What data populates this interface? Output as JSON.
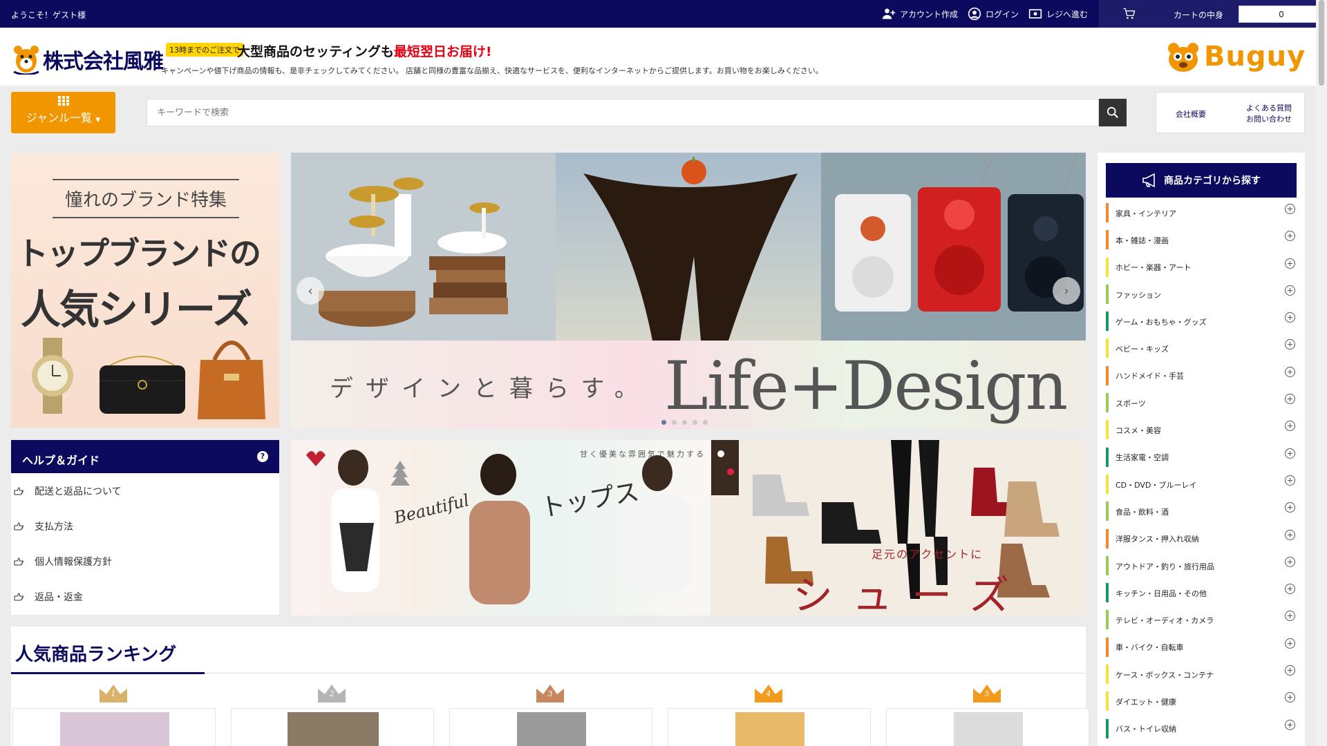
{
  "topbar": {
    "welcome": "ようこそ！ゲスト様",
    "create_account": "アカウント作成",
    "login": "ログイン",
    "checkout": "レジへ進む",
    "cart_label": "カートの中身",
    "cart_count": "0"
  },
  "header": {
    "company": "株式会社風雅",
    "promo_badge": "13時までのご注文で",
    "promo_main": "大型商品のセッティングも",
    "promo_red": "最短翌日お届け!",
    "tagline": "キャンペーンや値下げ商品の情報も、是非チェックしてみてください。 店舗と同様の豊富な品揃え、快適なサービスを、便利なインターネットからご提供します。お買い物をお楽しみください。",
    "brand": "Buguy"
  },
  "search": {
    "genre_label": "ジャンル一覧",
    "placeholder": "キーワードで検索"
  },
  "info_links": {
    "company": "会社概要",
    "faq_line1": "よくある質問",
    "faq_line2": "お問い合わせ"
  },
  "brand_banner": {
    "title": "憧れのブランド特集",
    "line1": "トップブランドの",
    "line2": "人気シリーズ"
  },
  "carousel": {
    "strip_jp": "デザインと暮らす。",
    "strip_en": "Life+Design",
    "slide_count": 5,
    "active_slide": 1
  },
  "help": {
    "title": "ヘルプ＆ガイド",
    "items": [
      "配送と返品について",
      "支払方法",
      "個人情報保護方針",
      "返品・返金"
    ]
  },
  "fashion_banner": {
    "subtitle": "甘く優美な雰囲気で魅力する",
    "english": "Beautiful",
    "japanese": "トップス"
  },
  "shoes_banner": {
    "subtitle": "足元のアクセントに",
    "japanese": "シューズ"
  },
  "ranking": {
    "title": "人気商品ランキング",
    "ranks": [
      "1",
      "2",
      "3",
      "4",
      "5"
    ],
    "crown_colors": [
      "#d9b26a",
      "#b5b5b5",
      "#c8865f",
      "#f29a1c",
      "#f29a1c"
    ]
  },
  "categories": {
    "title": "商品カテゴリから探す",
    "items": [
      {
        "label": "家具・インテリア",
        "color": "#f2872b"
      },
      {
        "label": "本・雑誌・漫画",
        "color": "#f2872b"
      },
      {
        "label": "ホビー・楽器・アート",
        "color": "#f5e33b"
      },
      {
        "label": "ファッション",
        "color": "#9acb57"
      },
      {
        "label": "ゲーム・おもちゃ・グッズ",
        "color": "#1a9a5e"
      },
      {
        "label": "ベビー・キッズ",
        "color": "#f5e33b"
      },
      {
        "label": "ハンドメイド・手芸",
        "color": "#f2872b"
      },
      {
        "label": "スポーツ",
        "color": "#9acb57"
      },
      {
        "label": "コスメ・美容",
        "color": "#f5e33b"
      },
      {
        "label": "生活家電・空調",
        "color": "#1a9a5e"
      },
      {
        "label": "CD・DVD・ブルーレイ",
        "color": "#f5e33b"
      },
      {
        "label": "食品・飲料・酒",
        "color": "#9acb57"
      },
      {
        "label": "洋服タンス・押入れ収納",
        "color": "#f2872b"
      },
      {
        "label": "アウトドア・釣り・旅行用品",
        "color": "#9acb57"
      },
      {
        "label": "キッチン・日用品・その他",
        "color": "#1a9a5e"
      },
      {
        "label": "テレビ・オーディオ・カメラ",
        "color": "#9acb57"
      },
      {
        "label": "車・バイク・自転車",
        "color": "#f2872b"
      },
      {
        "label": "ケース・ボックス・コンテナ",
        "color": "#f5e33b"
      },
      {
        "label": "ダイエット・健康",
        "color": "#f5e33b"
      },
      {
        "label": "バス・トイレ収納",
        "color": "#1a9a5e"
      }
    ]
  }
}
